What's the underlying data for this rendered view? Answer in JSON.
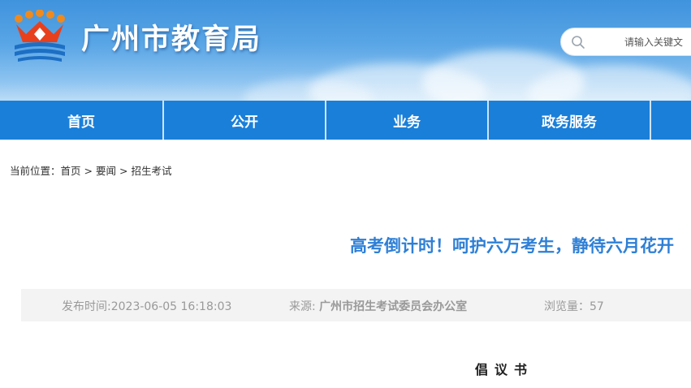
{
  "header": {
    "site_title": "广州市教育局",
    "search": {
      "placeholder": "请输入关键文"
    },
    "colors": {
      "banner": "#4a9ae0",
      "logo_red": "#e8401c",
      "logo_blue": "#1d6fc4"
    }
  },
  "nav": {
    "items": [
      {
        "label": "首页"
      },
      {
        "label": "公开"
      },
      {
        "label": "业务"
      },
      {
        "label": "政务服务"
      }
    ],
    "color": "#1a7fd9"
  },
  "breadcrumb": {
    "prefix": "当前位置：",
    "items": [
      "首页",
      "要闻",
      "招生考试"
    ],
    "separator": ">"
  },
  "article": {
    "title": "高考倒计时！呵护六万考生，静待六月花开",
    "publish_time": "发布时间:2023-06-05 16:18:03",
    "source_label": "来源: ",
    "source": "广州市招生考试委员会办公室",
    "views": "浏览量：57",
    "doc_heading": "倡议书",
    "title_color": "#2e7fd6"
  }
}
